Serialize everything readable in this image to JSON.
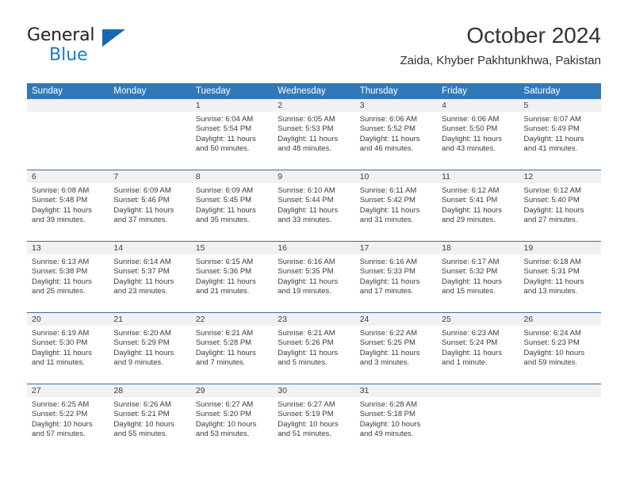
{
  "brand": {
    "line1": "General",
    "line2": "Blue",
    "icon": "triangle-logo-icon"
  },
  "header": {
    "title": "October 2024",
    "subtitle": "Zaida, Khyber Pakhtunkhwa, Pakistan"
  },
  "colors": {
    "header_blue": "#3278b9",
    "row_divider_blue": "#2f6fad",
    "daynum_band": "#f1f1f1",
    "brand_blue": "#1a7dc4",
    "text": "#333333"
  },
  "weekday_headers": [
    "Sunday",
    "Monday",
    "Tuesday",
    "Wednesday",
    "Thursday",
    "Friday",
    "Saturday"
  ],
  "labels": {
    "sunrise_prefix": "Sunrise:",
    "sunset_prefix": "Sunset:",
    "daylight_prefix": "Daylight:"
  },
  "weeks": [
    [
      {
        "day": "",
        "empty": true
      },
      {
        "day": "",
        "empty": true
      },
      {
        "day": "1",
        "sunrise": "Sunrise: 6:04 AM",
        "sunset": "Sunset: 5:54 PM",
        "daylight_a": "Daylight: 11 hours",
        "daylight_b": "and 50 minutes."
      },
      {
        "day": "2",
        "sunrise": "Sunrise: 6:05 AM",
        "sunset": "Sunset: 5:53 PM",
        "daylight_a": "Daylight: 11 hours",
        "daylight_b": "and 48 minutes."
      },
      {
        "day": "3",
        "sunrise": "Sunrise: 6:06 AM",
        "sunset": "Sunset: 5:52 PM",
        "daylight_a": "Daylight: 11 hours",
        "daylight_b": "and 46 minutes."
      },
      {
        "day": "4",
        "sunrise": "Sunrise: 6:06 AM",
        "sunset": "Sunset: 5:50 PM",
        "daylight_a": "Daylight: 11 hours",
        "daylight_b": "and 43 minutes."
      },
      {
        "day": "5",
        "sunrise": "Sunrise: 6:07 AM",
        "sunset": "Sunset: 5:49 PM",
        "daylight_a": "Daylight: 11 hours",
        "daylight_b": "and 41 minutes."
      }
    ],
    [
      {
        "day": "6",
        "sunrise": "Sunrise: 6:08 AM",
        "sunset": "Sunset: 5:48 PM",
        "daylight_a": "Daylight: 11 hours",
        "daylight_b": "and 39 minutes."
      },
      {
        "day": "7",
        "sunrise": "Sunrise: 6:09 AM",
        "sunset": "Sunset: 5:46 PM",
        "daylight_a": "Daylight: 11 hours",
        "daylight_b": "and 37 minutes."
      },
      {
        "day": "8",
        "sunrise": "Sunrise: 6:09 AM",
        "sunset": "Sunset: 5:45 PM",
        "daylight_a": "Daylight: 11 hours",
        "daylight_b": "and 35 minutes."
      },
      {
        "day": "9",
        "sunrise": "Sunrise: 6:10 AM",
        "sunset": "Sunset: 5:44 PM",
        "daylight_a": "Daylight: 11 hours",
        "daylight_b": "and 33 minutes."
      },
      {
        "day": "10",
        "sunrise": "Sunrise: 6:11 AM",
        "sunset": "Sunset: 5:42 PM",
        "daylight_a": "Daylight: 11 hours",
        "daylight_b": "and 31 minutes."
      },
      {
        "day": "11",
        "sunrise": "Sunrise: 6:12 AM",
        "sunset": "Sunset: 5:41 PM",
        "daylight_a": "Daylight: 11 hours",
        "daylight_b": "and 29 minutes."
      },
      {
        "day": "12",
        "sunrise": "Sunrise: 6:12 AM",
        "sunset": "Sunset: 5:40 PM",
        "daylight_a": "Daylight: 11 hours",
        "daylight_b": "and 27 minutes."
      }
    ],
    [
      {
        "day": "13",
        "sunrise": "Sunrise: 6:13 AM",
        "sunset": "Sunset: 5:38 PM",
        "daylight_a": "Daylight: 11 hours",
        "daylight_b": "and 25 minutes."
      },
      {
        "day": "14",
        "sunrise": "Sunrise: 6:14 AM",
        "sunset": "Sunset: 5:37 PM",
        "daylight_a": "Daylight: 11 hours",
        "daylight_b": "and 23 minutes."
      },
      {
        "day": "15",
        "sunrise": "Sunrise: 6:15 AM",
        "sunset": "Sunset: 5:36 PM",
        "daylight_a": "Daylight: 11 hours",
        "daylight_b": "and 21 minutes."
      },
      {
        "day": "16",
        "sunrise": "Sunrise: 6:16 AM",
        "sunset": "Sunset: 5:35 PM",
        "daylight_a": "Daylight: 11 hours",
        "daylight_b": "and 19 minutes."
      },
      {
        "day": "17",
        "sunrise": "Sunrise: 6:16 AM",
        "sunset": "Sunset: 5:33 PM",
        "daylight_a": "Daylight: 11 hours",
        "daylight_b": "and 17 minutes."
      },
      {
        "day": "18",
        "sunrise": "Sunrise: 6:17 AM",
        "sunset": "Sunset: 5:32 PM",
        "daylight_a": "Daylight: 11 hours",
        "daylight_b": "and 15 minutes."
      },
      {
        "day": "19",
        "sunrise": "Sunrise: 6:18 AM",
        "sunset": "Sunset: 5:31 PM",
        "daylight_a": "Daylight: 11 hours",
        "daylight_b": "and 13 minutes."
      }
    ],
    [
      {
        "day": "20",
        "sunrise": "Sunrise: 6:19 AM",
        "sunset": "Sunset: 5:30 PM",
        "daylight_a": "Daylight: 11 hours",
        "daylight_b": "and 11 minutes."
      },
      {
        "day": "21",
        "sunrise": "Sunrise: 6:20 AM",
        "sunset": "Sunset: 5:29 PM",
        "daylight_a": "Daylight: 11 hours",
        "daylight_b": "and 9 minutes."
      },
      {
        "day": "22",
        "sunrise": "Sunrise: 6:21 AM",
        "sunset": "Sunset: 5:28 PM",
        "daylight_a": "Daylight: 11 hours",
        "daylight_b": "and 7 minutes."
      },
      {
        "day": "23",
        "sunrise": "Sunrise: 6:21 AM",
        "sunset": "Sunset: 5:26 PM",
        "daylight_a": "Daylight: 11 hours",
        "daylight_b": "and 5 minutes."
      },
      {
        "day": "24",
        "sunrise": "Sunrise: 6:22 AM",
        "sunset": "Sunset: 5:25 PM",
        "daylight_a": "Daylight: 11 hours",
        "daylight_b": "and 3 minutes."
      },
      {
        "day": "25",
        "sunrise": "Sunrise: 6:23 AM",
        "sunset": "Sunset: 5:24 PM",
        "daylight_a": "Daylight: 11 hours",
        "daylight_b": "and 1 minute."
      },
      {
        "day": "26",
        "sunrise": "Sunrise: 6:24 AM",
        "sunset": "Sunset: 5:23 PM",
        "daylight_a": "Daylight: 10 hours",
        "daylight_b": "and 59 minutes."
      }
    ],
    [
      {
        "day": "27",
        "sunrise": "Sunrise: 6:25 AM",
        "sunset": "Sunset: 5:22 PM",
        "daylight_a": "Daylight: 10 hours",
        "daylight_b": "and 57 minutes."
      },
      {
        "day": "28",
        "sunrise": "Sunrise: 6:26 AM",
        "sunset": "Sunset: 5:21 PM",
        "daylight_a": "Daylight: 10 hours",
        "daylight_b": "and 55 minutes."
      },
      {
        "day": "29",
        "sunrise": "Sunrise: 6:27 AM",
        "sunset": "Sunset: 5:20 PM",
        "daylight_a": "Daylight: 10 hours",
        "daylight_b": "and 53 minutes."
      },
      {
        "day": "30",
        "sunrise": "Sunrise: 6:27 AM",
        "sunset": "Sunset: 5:19 PM",
        "daylight_a": "Daylight: 10 hours",
        "daylight_b": "and 51 minutes."
      },
      {
        "day": "31",
        "sunrise": "Sunrise: 6:28 AM",
        "sunset": "Sunset: 5:18 PM",
        "daylight_a": "Daylight: 10 hours",
        "daylight_b": "and 49 minutes."
      },
      {
        "day": "",
        "empty": true
      },
      {
        "day": "",
        "empty": true
      }
    ]
  ]
}
